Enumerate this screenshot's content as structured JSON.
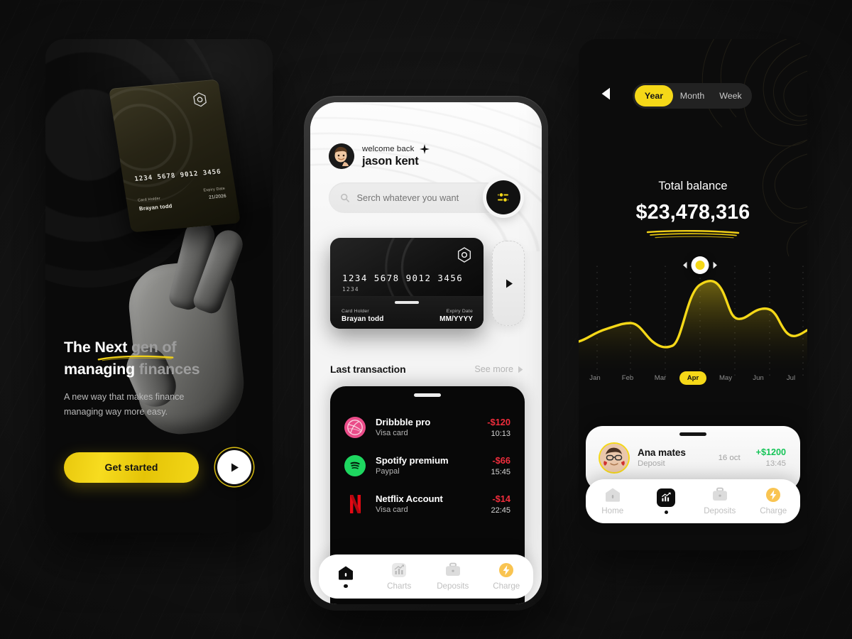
{
  "colors": {
    "background": "#191919",
    "accent_yellow": "#f5d818",
    "accent_orange": "#f6b93b",
    "negative_red": "#ef2d3c",
    "positive_green": "#15c457",
    "dark_card": "#080808"
  },
  "onboarding": {
    "headline_part1": "The ",
    "headline_underlined": "Next",
    "headline_part2": " gen of",
    "headline_line2_white": "managing ",
    "headline_line2_grey": "finances",
    "subtitle_line1": "A new way that makes finance",
    "subtitle_line2": "managing way more easy.",
    "cta_label": "Get started",
    "play_icon": "play-icon",
    "card": {
      "number": "1234 5678 9012 3456",
      "holder_label": "Card Holder",
      "holder_value": "Brayan todd",
      "expiry_label": "Expiry Date",
      "expiry_value": "21/2026",
      "logo_icon": "hexagon-gem-logo"
    }
  },
  "home": {
    "header": {
      "welcome": "welcome back",
      "name": "jason kent",
      "sparkle_icon": "sparkle-icon",
      "avatar": "user-avatar"
    },
    "search": {
      "placeholder": "Serch whatever you want",
      "value": "",
      "search_icon": "search-icon",
      "filter_icon": "sliders-filter-icon"
    },
    "card": {
      "number": "1234 5678 9012 3456",
      "last4": "1234",
      "holder_label": "Card Holder",
      "holder_value": "Brayan todd",
      "expiry_label": "Expiry Date",
      "expiry_value": "MM/YYYY",
      "logo_icon": "hexagon-gem-logo",
      "next_icon": "chevron-right-icon"
    },
    "section": {
      "title": "Last transaction",
      "see_more": "See more",
      "see_more_icon": "chevron-right-icon"
    },
    "transactions": [
      {
        "name": "Dribbble pro",
        "source": "Visa card",
        "amount": "-$120",
        "time": "10:13",
        "icon": "dribbble-icon",
        "color": "#ea4c89"
      },
      {
        "name": "Spotify premium",
        "source": "Paypal",
        "amount": "-$66",
        "time": "15:45",
        "icon": "spotify-icon",
        "color": "#1ed760"
      },
      {
        "name": "Netflix Account",
        "source": "Visa card",
        "amount": "-$14",
        "time": "22:45",
        "icon": "netflix-icon",
        "color": "#e50914"
      }
    ],
    "nav": [
      {
        "label": "",
        "icon": "home-icon",
        "active": true
      },
      {
        "label": "Charts",
        "icon": "chart-icon",
        "active": false
      },
      {
        "label": "Deposits",
        "icon": "briefcase-icon",
        "active": false
      },
      {
        "label": "Charge",
        "icon": "bolt-icon",
        "active": false
      }
    ]
  },
  "stats": {
    "back_icon": "back-arrow-icon",
    "range_tabs": [
      {
        "label": "Year",
        "active": true
      },
      {
        "label": "Month",
        "active": false
      },
      {
        "label": "Week",
        "active": false
      }
    ],
    "balance_label": "Total balance",
    "balance_amount": "$23,478,316",
    "handle_left_icon": "chevron-left-icon",
    "handle_right_icon": "chevron-right-icon",
    "deposit": {
      "name": "Ana mates",
      "type": "Deposit",
      "date": "16 oct",
      "amount": "+$1200",
      "time": "13:45",
      "avatar": "contact-avatar"
    },
    "nav": [
      {
        "label": "Home",
        "icon": "home-icon",
        "active": false
      },
      {
        "label": "",
        "icon": "chart-icon",
        "active": true
      },
      {
        "label": "Deposits",
        "icon": "briefcase-icon",
        "active": false
      },
      {
        "label": "Charge",
        "icon": "bolt-icon",
        "active": false
      }
    ]
  },
  "chart_data": {
    "type": "area",
    "title": "Total balance",
    "xlabel": "",
    "ylabel": "",
    "categories": [
      "Jan",
      "Feb",
      "Mar",
      "Apr",
      "May",
      "Jun",
      "Jul"
    ],
    "values": [
      28,
      44,
      26,
      92,
      58,
      66,
      30
    ],
    "highlighted_category": "Apr",
    "highlighted_value": 92,
    "ylim": [
      0,
      100
    ],
    "grid": "dotted-vertical",
    "line_color": "#f5d818",
    "fill": "yellow-to-black-gradient",
    "legend": "none"
  }
}
